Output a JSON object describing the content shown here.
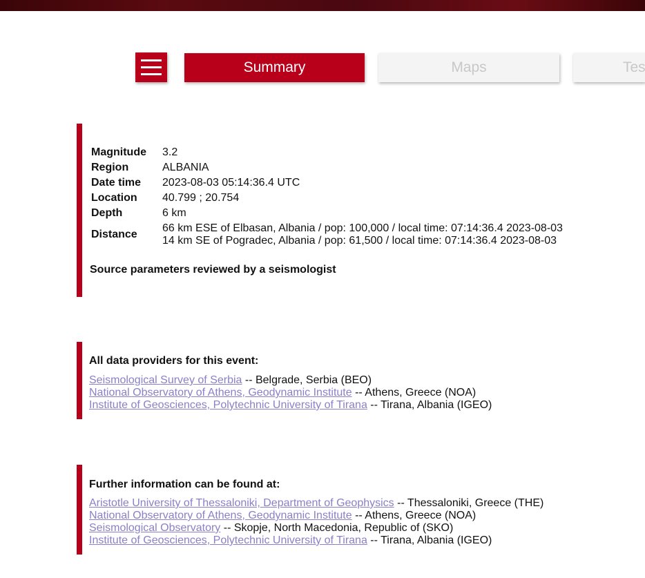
{
  "tabs": [
    {
      "label": "Summary",
      "active": true
    },
    {
      "label": "Maps",
      "active": false
    },
    {
      "label": "Tes",
      "active": false
    }
  ],
  "summary": {
    "rows": [
      {
        "label": "Magnitude",
        "value": "3.2"
      },
      {
        "label": "Region",
        "value": "ALBANIA"
      },
      {
        "label": "Date time",
        "value": "2023-08-03 05:14:36.4 UTC"
      },
      {
        "label": "Location",
        "value": "40.799 ; 20.754"
      },
      {
        "label": "Depth",
        "value": "6 km"
      }
    ],
    "distance_label": "Distance",
    "distance_lines": [
      "66 km ESE of Elbasan, Albania / pop: 100,000 / local time: 07:14:36.4 2023-08-03",
      "14 km SE of Pogradec, Albania / pop: 61,500 / local time: 07:14:36.4 2023-08-03"
    ],
    "reviewed": "Source parameters reviewed by a seismologist"
  },
  "providers": {
    "title": "All data providers for this event:",
    "items": [
      {
        "link": "Seismological Survey of Serbia",
        "detail": " -- Belgrade, Serbia (BEO)"
      },
      {
        "link": "National Observatory of Athens, Geodynamic Institute",
        "detail": " -- Athens, Greece (NOA)"
      },
      {
        "link": "Institute of Geosciences, Polytechnic University of Tirana",
        "detail": " -- Tirana, Albania (IGEO)"
      }
    ]
  },
  "further": {
    "title": "Further information can be found at:",
    "items": [
      {
        "link": "Aristotle University of Thessaloniki, Department of Geophysics",
        "detail": " -- Thessaloniki, Greece (THE)"
      },
      {
        "link": "National Observatory of Athens, Geodynamic Institute",
        "detail": " -- Athens, Greece (NOA)"
      },
      {
        "link": "Seismological Observatory",
        "detail": " -- Skopje, North Macedonia, Republic of (SKO)"
      },
      {
        "link": "Institute of Geosciences, Polytechnic University of Tirana",
        "detail": " -- Tirana, Albania (IGEO)"
      }
    ]
  },
  "colors": {
    "accent": "#b8001a",
    "link": "#8a80c8",
    "inactive_tab_bg": "#f4f4f4",
    "inactive_tab_text": "#c8c8c8"
  },
  "icons": {
    "menu": "hamburger-menu-icon"
  }
}
